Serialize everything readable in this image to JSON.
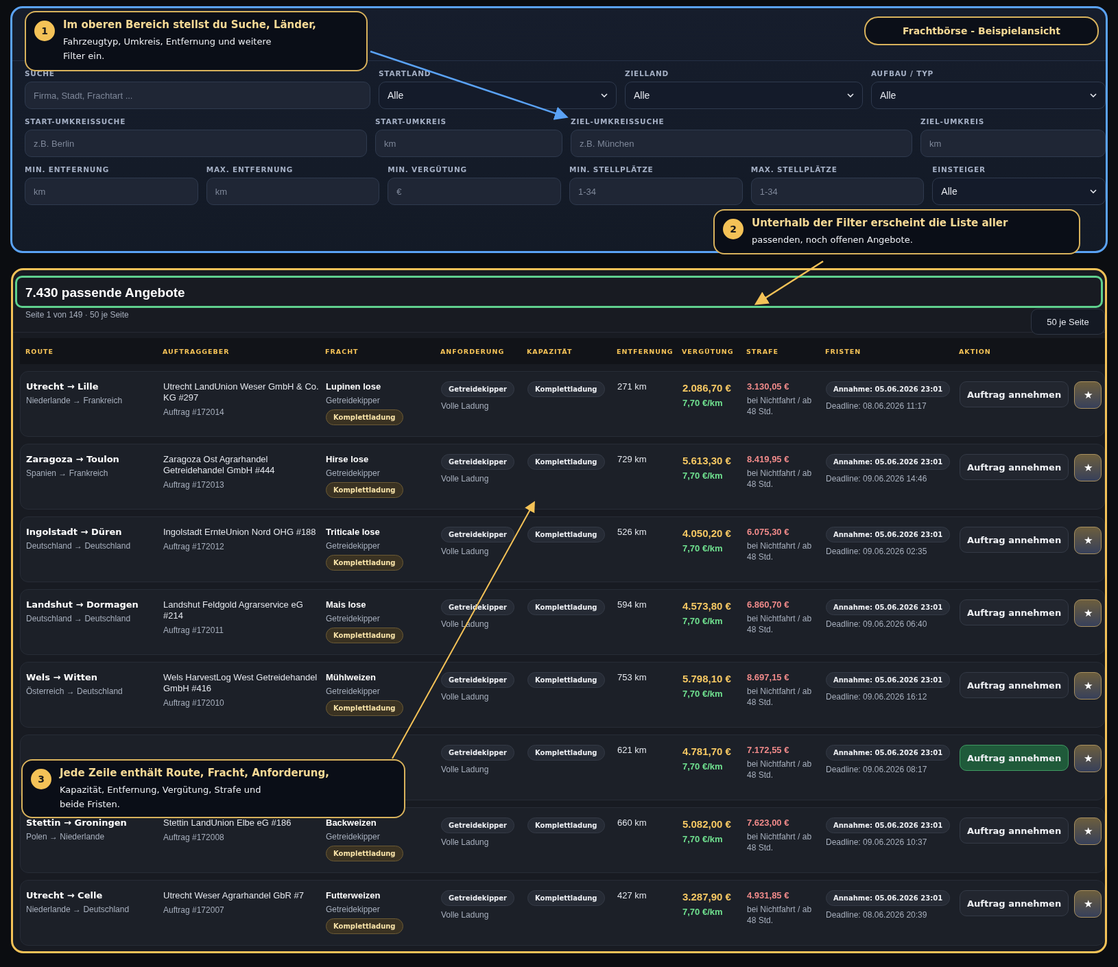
{
  "header_badge": "Frachtbörse - Beispielansicht",
  "filters": {
    "rows": [
      {
        "fields": [
          {
            "label": "SUCHE",
            "kind": "input",
            "placeholder": "Firma, Stadt, Frachtart ..."
          },
          {
            "label": "STARTLAND",
            "kind": "select",
            "value": "Alle"
          },
          {
            "label": "ZIELLAND",
            "kind": "select",
            "value": "Alle"
          },
          {
            "label": "AUFBAU / TYP",
            "kind": "select",
            "value": "Alle"
          }
        ]
      },
      {
        "fields": [
          {
            "label": "START-UMKREISSUCHE",
            "kind": "input",
            "placeholder": "z.B. Berlin"
          },
          {
            "label": "START-UMKREIS",
            "kind": "input",
            "placeholder": "km"
          },
          {
            "label": "ZIEL-UMKREISSUCHE",
            "kind": "input",
            "placeholder": "z.B. München"
          },
          {
            "label": "ZIEL-UMKREIS",
            "kind": "input",
            "placeholder": "km"
          }
        ]
      },
      {
        "fields": [
          {
            "label": "MIN. ENTFERNUNG",
            "kind": "input",
            "placeholder": "km"
          },
          {
            "label": "MAX. ENTFERNUNG",
            "kind": "input",
            "placeholder": "km"
          },
          {
            "label": "MIN. VERGÜTUNG",
            "kind": "input",
            "placeholder": "€"
          },
          {
            "label": "MIN. STELLPLÄTZE",
            "kind": "input",
            "placeholder": "1-34"
          },
          {
            "label": "MAX. STELLPLÄTZE",
            "kind": "input",
            "placeholder": "1-34"
          },
          {
            "label": "EINSTEIGER",
            "kind": "select",
            "value": "Alle"
          }
        ]
      }
    ]
  },
  "results": {
    "title": "7.430 passende Angebote",
    "subtitle": "Seite 1 von 149 · 50 je Seite",
    "page_size": "50 je Seite"
  },
  "table": {
    "columns": [
      "ROUTE",
      "AUFTRAGGEBER",
      "FRACHT",
      "ANFORDERUNG",
      "KAPAZITÄT",
      "ENTFERNUNG",
      "VERGÜTUNG",
      "STRAFE",
      "FRISTEN",
      "AKTION"
    ],
    "rows": [
      {
        "route": "Utrecht → Lille",
        "countries": "Niederlande → Frankreich",
        "client": "Utrecht LandUnion Weser GmbH & Co. KG #297",
        "order": "Auftrag #172014",
        "freight": "Lupinen lose",
        "vehicle": "Getreidekipper",
        "freight_badge": "Komplettladung",
        "requirement": "Getreidekipper",
        "requirement_note": "Volle Ladung",
        "capacity": "Komplettladung",
        "distance": "271 km",
        "price": "2.086,70 €",
        "per_km": "7,70 €/km",
        "penalty": "3.130,05 €",
        "penalty_note": "bei Nichtfahrt / ab 48 Std.",
        "acceptance": "Annahme: 05.06.2026 23:01",
        "deadline": "Deadline: 08.06.2026 11:17",
        "action": "Auftrag annehmen",
        "star": "★",
        "highlighted": false
      },
      {
        "route": "Zaragoza → Toulon",
        "countries": "Spanien → Frankreich",
        "client": "Zaragoza Ost Agrarhandel Getreidehandel GmbH #444",
        "order": "Auftrag #172013",
        "freight": "Hirse lose",
        "vehicle": "Getreidekipper",
        "freight_badge": "Komplettladung",
        "requirement": "Getreidekipper",
        "requirement_note": "Volle Ladung",
        "capacity": "Komplettladung",
        "distance": "729 km",
        "price": "5.613,30 €",
        "per_km": "7,70 €/km",
        "penalty": "8.419,95 €",
        "penalty_note": "bei Nichtfahrt / ab 48 Std.",
        "acceptance": "Annahme: 05.06.2026 23:01",
        "deadline": "Deadline: 09.06.2026 14:46",
        "action": "Auftrag annehmen",
        "star": "★",
        "highlighted": false
      },
      {
        "route": "Ingolstadt → Düren",
        "countries": "Deutschland → Deutschland",
        "client": "Ingolstadt ErnteUnion Nord OHG #188",
        "order": "Auftrag #172012",
        "freight": "Triticale lose",
        "vehicle": "Getreidekipper",
        "freight_badge": "Komplettladung",
        "requirement": "Getreidekipper",
        "requirement_note": "Volle Ladung",
        "capacity": "Komplettladung",
        "distance": "526 km",
        "price": "4.050,20 €",
        "per_km": "7,70 €/km",
        "penalty": "6.075,30 €",
        "penalty_note": "bei Nichtfahrt / ab 48 Std.",
        "acceptance": "Annahme: 05.06.2026 23:01",
        "deadline": "Deadline: 09.06.2026 02:35",
        "action": "Auftrag annehmen",
        "star": "★",
        "highlighted": false
      },
      {
        "route": "Landshut → Dormagen",
        "countries": "Deutschland → Deutschland",
        "client": "Landshut Feldgold Agrarservice eG #214",
        "order": "Auftrag #172011",
        "freight": "Mais lose",
        "vehicle": "Getreidekipper",
        "freight_badge": "Komplettladung",
        "requirement": "Getreidekipper",
        "requirement_note": "Volle Ladung",
        "capacity": "Komplettladung",
        "distance": "594 km",
        "price": "4.573,80 €",
        "per_km": "7,70 €/km",
        "penalty": "6.860,70 €",
        "penalty_note": "bei Nichtfahrt / ab 48 Std.",
        "acceptance": "Annahme: 05.06.2026 23:01",
        "deadline": "Deadline: 09.06.2026 06:40",
        "action": "Auftrag annehmen",
        "star": "★",
        "highlighted": false
      },
      {
        "route": "Wels → Witten",
        "countries": "Österreich → Deutschland",
        "client": "Wels HarvestLog West Getreidehandel GmbH #416",
        "order": "Auftrag #172010",
        "freight": "Mühlweizen",
        "vehicle": "Getreidekipper",
        "freight_badge": "Komplettladung",
        "requirement": "Getreidekipper",
        "requirement_note": "Volle Ladung",
        "capacity": "Komplettladung",
        "distance": "753 km",
        "price": "5.798,10 €",
        "per_km": "7,70 €/km",
        "penalty": "8.697,15 €",
        "penalty_note": "bei Nichtfahrt / ab 48 Std.",
        "acceptance": "Annahme: 05.06.2026 23:01",
        "deadline": "Deadline: 09.06.2026 16:12",
        "action": "Auftrag annehmen",
        "star": "★",
        "highlighted": false
      },
      {
        "requirement": "Getreidekipper",
        "requirement_note": "Volle Ladung",
        "capacity": "Komplettladung",
        "distance": "621 km",
        "price": "4.781,70 €",
        "per_km": "7,70 €/km",
        "penalty": "7.172,55 €",
        "penalty_note": "bei Nichtfahrt / ab 48 Std.",
        "acceptance": "Annahme: 05.06.2026 23:01",
        "deadline": "Deadline: 09.06.2026 08:17",
        "action": "Auftrag annehmen",
        "star": "★",
        "highlighted": true
      },
      {
        "route": "Stettin → Groningen",
        "countries": "Polen → Niederlande",
        "client": "Stettin LandUnion Elbe eG #186",
        "order": "Auftrag #172008",
        "freight": "Backweizen",
        "vehicle": "Getreidekipper",
        "freight_badge": "Komplettladung",
        "requirement": "Getreidekipper",
        "requirement_note": "Volle Ladung",
        "capacity": "Komplettladung",
        "distance": "660 km",
        "price": "5.082,00 €",
        "per_km": "7,70 €/km",
        "penalty": "7.623,00 €",
        "penalty_note": "bei Nichtfahrt / ab 48 Std.",
        "acceptance": "Annahme: 05.06.2026 23:01",
        "deadline": "Deadline: 09.06.2026 10:37",
        "action": "Auftrag annehmen",
        "star": "★",
        "highlighted": false
      },
      {
        "route": "Utrecht → Celle",
        "countries": "Niederlande → Deutschland",
        "client": "Utrecht Weser Agrarhandel GbR #7",
        "order": "Auftrag #172007",
        "freight": "Futterweizen",
        "vehicle": "Getreidekipper",
        "freight_badge": "Komplettladung",
        "requirement": "Getreidekipper",
        "requirement_note": "Volle Ladung",
        "capacity": "Komplettladung",
        "distance": "427 km",
        "price": "3.287,90 €",
        "per_km": "7,70 €/km",
        "penalty": "4.931,85 €",
        "penalty_note": "bei Nichtfahrt / ab 48 Std.",
        "acceptance": "Annahme: 05.06.2026 23:01",
        "deadline": "Deadline: 08.06.2026 20:39",
        "action": "Auftrag annehmen",
        "star": "★",
        "highlighted": false
      }
    ]
  },
  "callouts": [
    {
      "number": "1",
      "title": "Im oberen Bereich stellst du Suche, Länder,",
      "text": "Fahrzeugtyp, Umkreis, Entfernung und weitere Filter ein."
    },
    {
      "number": "2",
      "title": "Unterhalb der Filter erscheint die Liste aller",
      "text": "passenden, noch offenen Angebote."
    },
    {
      "number": "3",
      "title": "Jede Zeile enthält Route, Fracht, Anforderung,",
      "text": "Kapazität, Entfernung, Vergütung, Strafe und beide Fristen."
    }
  ]
}
